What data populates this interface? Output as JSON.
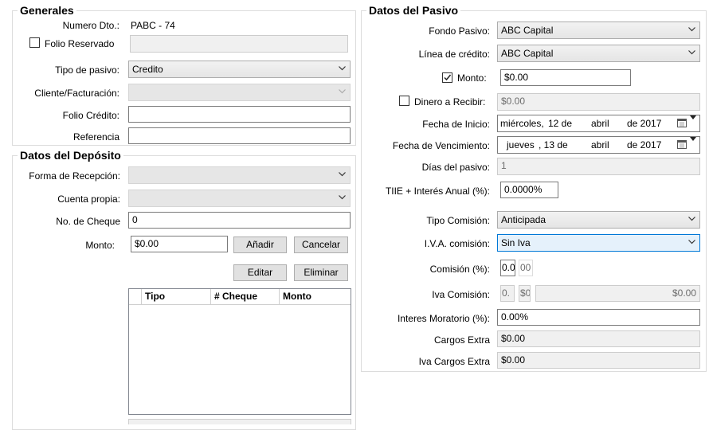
{
  "generales": {
    "title": "Generales",
    "numero_dto_label": "Numero Dto.:",
    "numero_dto_value": "PABC - 74",
    "folio_reservado_label": "Folio Reservado",
    "tipo_pasivo_label": "Tipo de pasivo:",
    "tipo_pasivo_value": "Credito",
    "cliente_facturacion_label": "Cliente/Facturación:",
    "folio_credito_label": "Folio Crédito:",
    "referencia_label": "Referencia"
  },
  "deposito": {
    "title": "Datos del Depósito",
    "forma_recepcion_label": "Forma de Recepción:",
    "cuenta_propia_label": "Cuenta propia:",
    "no_cheque_label": "No. de Cheque",
    "no_cheque_value": "0",
    "monto_label": "Monto:",
    "monto_value": "$0.00",
    "anadir_label": "Añadir",
    "cancelar_label": "Cancelar",
    "editar_label": "Editar",
    "eliminar_label": "Eliminar",
    "grid_columns": [
      "Tipo",
      "# Cheque",
      "Monto"
    ]
  },
  "pasivo": {
    "title": "Datos del Pasivo",
    "fondo_pasivo_label": "Fondo Pasivo:",
    "fondo_pasivo_value": "ABC Capital",
    "linea_credito_label": "Línea de crédito:",
    "linea_credito_value": "ABC Capital",
    "monto_label": "Monto:",
    "monto_checked": true,
    "monto_value": "$0.00",
    "dinero_recibir_label": "Dinero a Recibir:",
    "dinero_recibir_checked": false,
    "dinero_recibir_value": "$0.00",
    "fecha_inicio_label": "Fecha de Inicio:",
    "fecha_inicio": {
      "weekday": "miércoles,",
      "day": "12 de",
      "month": "abril",
      "year": "de 2017"
    },
    "fecha_venc_label": "Fecha de Vencimiento:",
    "fecha_venc": {
      "weekday": "jueves",
      "day": ", 13 de",
      "month": "abril",
      "year": "de 2017"
    },
    "dias_label": "Días del pasivo:",
    "dias_value": "1",
    "tiie_label": "TIIE + Interés Anual (%):",
    "tiie_value": "0.0000%",
    "tipo_comision_label": "Tipo Comisión:",
    "tipo_comision_value": "Anticipada",
    "iva_comision_label": "I.V.A. comisión:",
    "iva_comision_value": "Sin Iva",
    "comision_label": "Comisión (%):",
    "comision_value_a": "0.0",
    "comision_value_b": "00",
    "iva_comision2_label": "Iva Comisión:",
    "iva_comision2_a": "0.",
    "iva_comision2_b": "$0",
    "iva_comision2_total": "$0.00",
    "interes_moratorio_label": "Interes Moratorio (%):",
    "interes_moratorio_value": "0.00%",
    "cargos_extra_label": "Cargos Extra",
    "cargos_extra_value": "$0.00",
    "iva_cargos_extra_label": "Iva Cargos Extra",
    "iva_cargos_extra_value": "$0.00"
  },
  "icons": {
    "chevron": "chevron-down-icon",
    "checkmark": "checkmark-icon",
    "calendar": "calendar-icon"
  }
}
